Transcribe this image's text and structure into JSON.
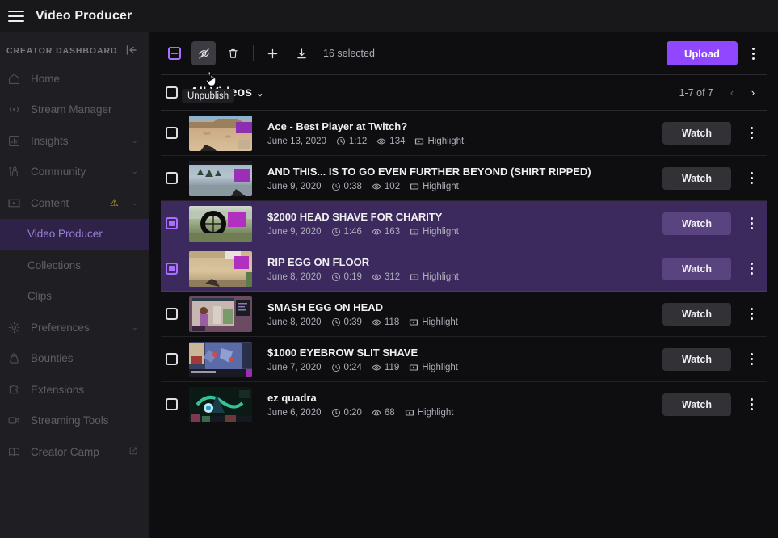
{
  "topbar": {
    "menu_icon": "hamburger-menu-icon",
    "title": "Video Producer"
  },
  "sidebar": {
    "header_label": "CREATOR DASHBOARD",
    "collapse_icon": "collapse-left-icon",
    "items": [
      {
        "label": "Home",
        "icon": "home-icon",
        "chevron": "",
        "badge": "",
        "external": ""
      },
      {
        "label": "Stream Manager",
        "icon": "broadcast-icon",
        "chevron": "",
        "badge": "",
        "external": ""
      },
      {
        "label": "Insights",
        "icon": "bar-chart-icon",
        "chevron": "⌄",
        "badge": "",
        "external": ""
      },
      {
        "label": "Community",
        "icon": "people-icon",
        "chevron": "⌄",
        "badge": "",
        "external": ""
      },
      {
        "label": "Content",
        "icon": "content-frame-icon",
        "chevron": "⌄",
        "badge": "⚠",
        "external": ""
      }
    ],
    "sub_items": [
      {
        "label": "Video Producer",
        "active": true
      },
      {
        "label": "Collections",
        "active": false
      },
      {
        "label": "Clips",
        "active": false
      }
    ],
    "items2": [
      {
        "label": "Preferences",
        "icon": "gear-icon",
        "chevron": "⌄",
        "badge": "",
        "external": ""
      },
      {
        "label": "Bounties",
        "icon": "bounty-bag-icon",
        "chevron": "",
        "badge": "",
        "external": ""
      },
      {
        "label": "Extensions",
        "icon": "puzzle-icon",
        "chevron": "",
        "badge": "",
        "external": ""
      },
      {
        "label": "Streaming Tools",
        "icon": "video-camera-icon",
        "chevron": "",
        "badge": "",
        "external": ""
      },
      {
        "label": "Creator Camp",
        "icon": "book-icon",
        "chevron": "",
        "badge": "",
        "external": "↗"
      }
    ]
  },
  "toolbar": {
    "select_all_icon": "checkbox-indeterminate-icon",
    "unpublish_icon": "eye-slash-icon",
    "delete_icon": "trash-icon",
    "add_icon": "plus-icon",
    "download_icon": "download-icon",
    "selected_count": "16 selected",
    "upload_label": "Upload",
    "more_icon": "kebab-menu-icon",
    "tooltip": "Unpublish"
  },
  "subbar": {
    "select_all_checkbox": "checkbox-unchecked-icon",
    "filter_label": "All Videos",
    "filter_chevron": "⌄",
    "pager_label": "1-7 of 7",
    "prev_icon": "chevron-left-icon",
    "next_icon": "chevron-right-icon",
    "prev_glyph": "‹",
    "next_glyph": "›"
  },
  "columns": {
    "watch_label": "Watch",
    "row_more_icon": "kebab-menu-icon",
    "clock_icon": "clock-icon",
    "views_icon": "eye-icon",
    "type_icon": "highlight-icon"
  },
  "colors": {
    "accent": "#9147ff",
    "accent_light": "#a970ff",
    "selected_row_bg": "#3c2a5e",
    "page_bg": "#0e0e10",
    "panel_bg": "#1f1f23",
    "warning": "#c8a020"
  },
  "videos": [
    {
      "title": "Ace - Best Player at Twitch?",
      "date": "June 13, 2020",
      "duration": "1:12",
      "views": "134",
      "type": "Highlight",
      "selected": false,
      "thumb": "desert-gameplay"
    },
    {
      "title": "AND THIS... IS TO GO EVEN FURTHER BEYOND (SHIRT RIPPED)",
      "date": "June 9, 2020",
      "duration": "0:38",
      "views": "102",
      "type": "Highlight",
      "selected": false,
      "thumb": "snow-forest-gameplay"
    },
    {
      "title": "$2000 HEAD SHAVE FOR CHARITY",
      "date": "June 9, 2020",
      "duration": "1:46",
      "views": "163",
      "type": "Highlight",
      "selected": true,
      "thumb": "scope-gameplay"
    },
    {
      "title": "RIP EGG ON FLOOR",
      "date": "June 8, 2020",
      "duration": "0:19",
      "views": "312",
      "type": "Highlight",
      "selected": true,
      "thumb": "sand-hill-gameplay"
    },
    {
      "title": "SMASH EGG ON HEAD",
      "date": "June 8, 2020",
      "duration": "0:39",
      "views": "118",
      "type": "Highlight",
      "selected": false,
      "thumb": "webcam-room"
    },
    {
      "title": "$1000 EYEBROW SLIT SHAVE",
      "date": "June 7, 2020",
      "duration": "0:24",
      "views": "119",
      "type": "Highlight",
      "selected": false,
      "thumb": "blue-map-gameplay"
    },
    {
      "title": "ez quadra",
      "date": "June 6, 2020",
      "duration": "0:20",
      "views": "68",
      "type": "Highlight",
      "selected": false,
      "thumb": "green-neon-gameplay"
    }
  ]
}
